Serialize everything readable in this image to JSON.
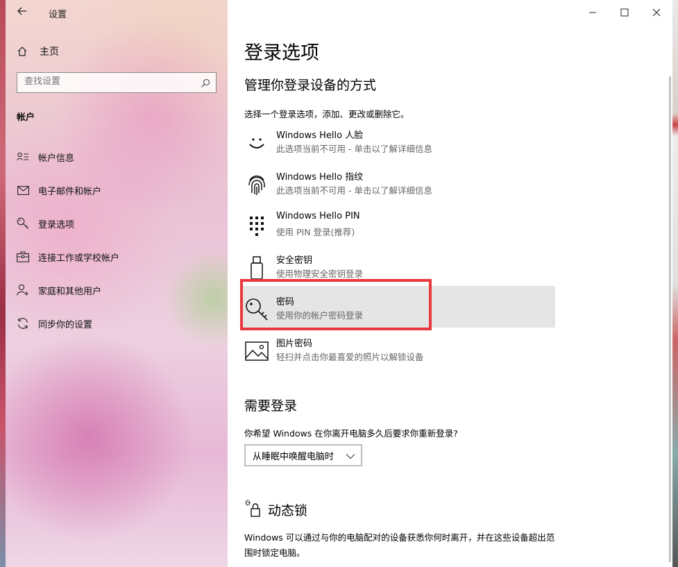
{
  "window": {
    "app_title": "设置",
    "minimize_glyph": "—",
    "maximize_glyph": "☐",
    "close_glyph": "✕"
  },
  "sidebar": {
    "home_label": "主页",
    "search_placeholder": "查找设置",
    "section_heading": "帐户",
    "items": [
      {
        "label": "帐户信息",
        "icon": "person-card-icon"
      },
      {
        "label": "电子邮件和帐户",
        "icon": "mail-icon"
      },
      {
        "label": "登录选项",
        "icon": "key-icon"
      },
      {
        "label": "连接工作或学校帐户",
        "icon": "briefcase-icon"
      },
      {
        "label": "家庭和其他用户",
        "icon": "add-person-icon"
      },
      {
        "label": "同步你的设置",
        "icon": "sync-icon"
      }
    ]
  },
  "main": {
    "title": "登录选项",
    "subtitle": "管理你登录设备的方式",
    "description": "选择一个登录选项，添加、更改或删除它。",
    "options": [
      {
        "title": "Windows Hello 人脸",
        "subtitle": "此选项当前不可用 - 单击以了解详细信息",
        "icon": "face-icon"
      },
      {
        "title": "Windows Hello 指纹",
        "subtitle": "此选项当前不可用 - 单击以了解详细信息",
        "icon": "fingerprint-icon"
      },
      {
        "title": "Windows Hello PIN",
        "subtitle": "使用 PIN 登录(推荐)",
        "icon": "pin-keypad-icon"
      },
      {
        "title": "安全密钥",
        "subtitle": "使用物理安全密钥登录",
        "icon": "usb-key-icon"
      },
      {
        "title": "密码",
        "subtitle": "使用你的帐户密码登录",
        "icon": "key-icon",
        "selected": true
      },
      {
        "title": "图片密码",
        "subtitle": "轻扫并点击你最喜爱的照片以解锁设备",
        "icon": "picture-icon"
      }
    ],
    "require_signin": {
      "heading": "需要登录",
      "question": "你希望 Windows 在你离开电脑多久后要求你重新登录?",
      "dropdown_value": "从睡眠中唤醒电脑时"
    },
    "dynamic_lock": {
      "heading": "动态锁",
      "text": "Windows 可以通过与你的电脑配对的设备获悉你何时离开，并在这些设备超出范围时锁定电脑。"
    }
  },
  "colors": {
    "highlight_border": "#e8383d",
    "selected_bg": "#e5e5e5"
  }
}
